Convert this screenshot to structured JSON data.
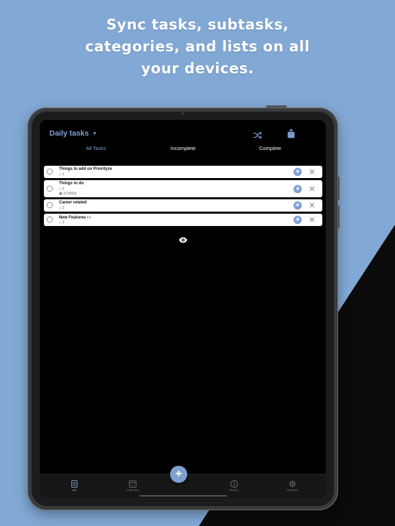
{
  "headline": {
    "line1": "Sync tasks, subtasks,",
    "line2": "categories, and lists on all",
    "line3": "your devices."
  },
  "app": {
    "list_title": "Daily tasks",
    "caret": "▼",
    "filters": [
      "All Tasks",
      "Incomplete",
      "Complete"
    ],
    "active_filter": "All Tasks",
    "tasks": [
      {
        "title": "Things to add on Priorityze",
        "subtask_count": "2",
        "date": ""
      },
      {
        "title": "Things to do",
        "subtask_count": "2",
        "date": "1/7/2023"
      },
      {
        "title": "Career related",
        "subtask_count": "2",
        "date": ""
      },
      {
        "title": "New Features 👀",
        "subtask_count": "2",
        "date": ""
      }
    ],
    "add_subtask_symbol": "+",
    "delete_symbol": "✕",
    "fab_symbol": "+",
    "tabs": [
      {
        "label": "List",
        "icon": "list-icon",
        "active": true
      },
      {
        "label": "Calendar",
        "icon": "calendar-icon",
        "active": false
      },
      {
        "label": "History",
        "icon": "info-icon",
        "active": false
      },
      {
        "label": "Settings",
        "icon": "gear-icon",
        "active": false
      }
    ]
  },
  "colors": {
    "background": "#82a9d5",
    "accent": "#7ea0d0",
    "screen": "#000000"
  }
}
